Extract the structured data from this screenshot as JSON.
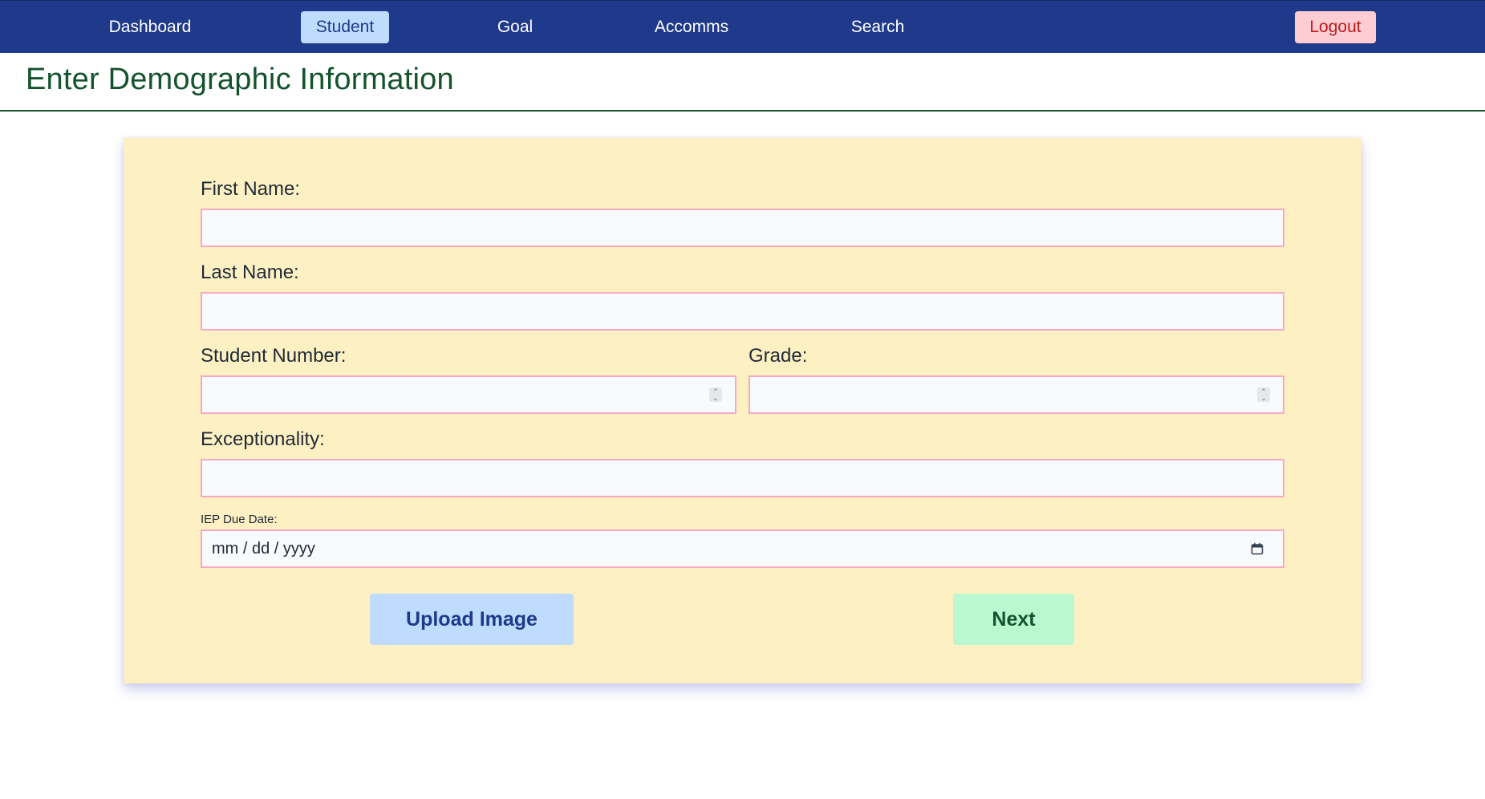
{
  "nav": {
    "dashboard": "Dashboard",
    "student": "Student",
    "goal": "Goal",
    "accomms": "Accomms",
    "search": "Search",
    "logout": "Logout"
  },
  "page": {
    "title": "Enter Demographic Information"
  },
  "form": {
    "first_name_label": "First Name:",
    "first_name_value": "",
    "last_name_label": "Last Name:",
    "last_name_value": "",
    "student_number_label": "Student Number:",
    "student_number_value": "",
    "grade_label": "Grade:",
    "grade_value": "",
    "exceptionality_label": "Exceptionality:",
    "exceptionality_value": "",
    "iep_due_date_label": "IEP Due Date:",
    "iep_due_date_placeholder": "mm / dd / yyyy"
  },
  "buttons": {
    "upload_image": "Upload Image",
    "next": "Next"
  },
  "icons": {
    "number_spinner": "spinner-icon",
    "date_picker": "calendar-icon"
  },
  "colors": {
    "nav_bg": "#1f3a8a",
    "active_tab_bg": "#bfdbfe",
    "logout_bg": "#fecdd3",
    "title_color": "#14532d",
    "card_bg": "#fdf0c2",
    "field_border": "#f9a8c4",
    "upload_bg": "#bfdbfe",
    "next_bg": "#bbf7d0"
  }
}
